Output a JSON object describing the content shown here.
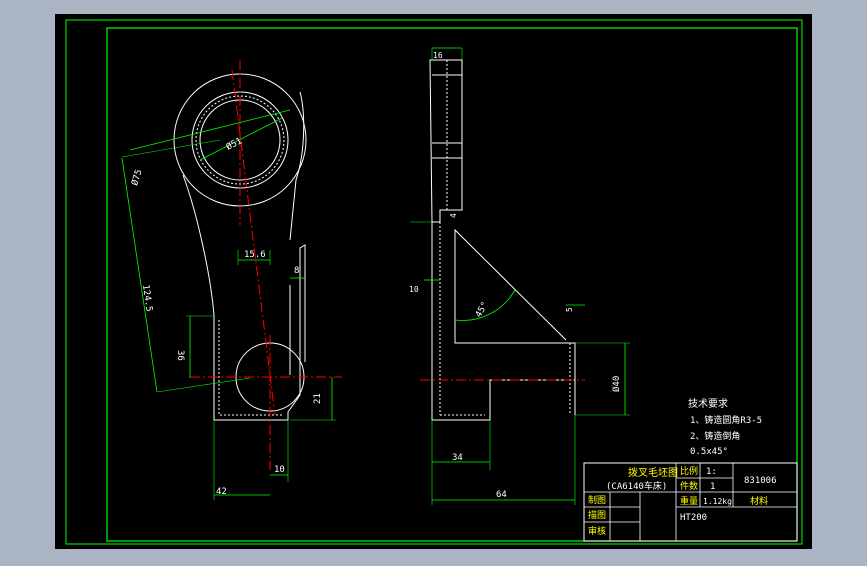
{
  "colors": {
    "background": "#000000",
    "viewport_frame": "#abb4c2",
    "border": "#00ff00",
    "outline": "#ffffff",
    "dimension": "#00ff00",
    "centerline": "#ff0000",
    "annotation_text": "#ffffff",
    "title_text": "#ffff00"
  },
  "dimensions": {
    "bore_dia": "Ø51",
    "outer_dia": "Ø75",
    "center_distance": "124.5",
    "offset_15_6": "15.6",
    "rib_width": "8",
    "left_height": "36",
    "bottom_radius": "21",
    "bottom_offset": "10",
    "base_width": "42",
    "top_width": "16",
    "rib_thickness": "4",
    "plate_thickness": "10",
    "angle": "45°",
    "arm_thickness": "5",
    "boss_dia": "Ø40",
    "mid_width": "34",
    "overall_length": "64"
  },
  "tech_requirements": {
    "heading": "技术要求",
    "item1": "1、铸造圆角R3-5",
    "item2": "2、铸造倒角",
    "item3": "0.5x45°"
  },
  "title_block": {
    "part_name": "拨叉毛坯图",
    "machine": "(CA6140车床)",
    "scale_label": "比例",
    "scale_value": "1:",
    "drawing_number": "831006",
    "quantity_label": "件数",
    "quantity_value": "1",
    "weight_label": "重量",
    "weight_value": "1.12kg",
    "material_label": "材料",
    "material_value": "HT200",
    "drawn_label": "制图",
    "drawn2_label": "描图",
    "check_label": "审核"
  }
}
